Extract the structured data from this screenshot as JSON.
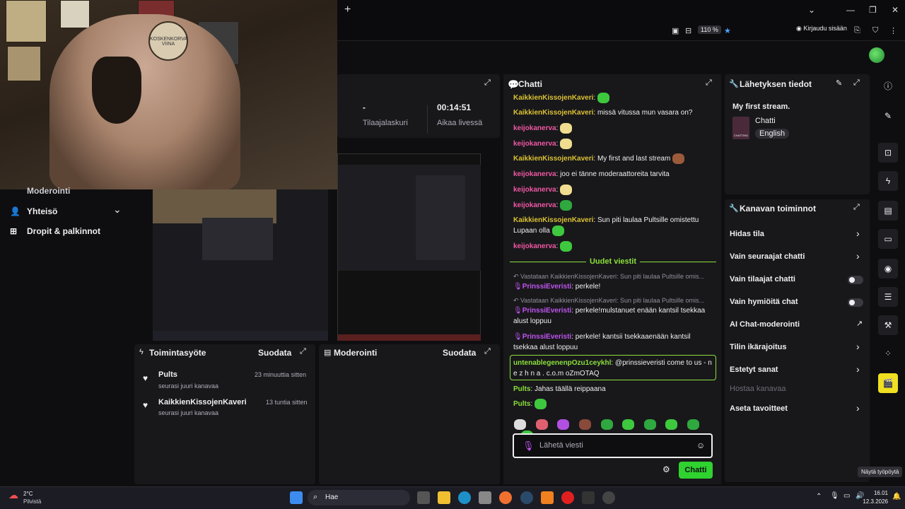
{
  "stats": {
    "left_value": "-",
    "left_label": "Tilaajalaskuri",
    "right_value": "00:14:51",
    "right_label": "Aikaa livessä"
  },
  "browser": {
    "zoom": "110 %",
    "login": "Kirjaudu sisään"
  },
  "webcam": {
    "stamp_text": "KOSKENKORVA VIINA"
  },
  "leftnav": {
    "items": [
      "Moderointi",
      "Yhteisö",
      "Dropit & palkinnot"
    ]
  },
  "chat": {
    "title": "Chatti",
    "messages": [
      {
        "user": "KaikkienKissojenKaveri",
        "text": ""
      },
      {
        "user": "KaikkienKissojenKaveri",
        "text": ": missä vitussa mun vasara on?"
      },
      {
        "user": "keijokanerva",
        "text": ":"
      },
      {
        "user": "keijokanerva",
        "text": ":"
      },
      {
        "user": "KaikkienKissojenKaveri",
        "text": ": My first and last stream"
      },
      {
        "user": "keijokanerva",
        "text": ": joo ei tänne moderaattoreita tarvita"
      },
      {
        "user": "keijokanerva",
        "text": ":"
      },
      {
        "user": "keijokanerva",
        "text": ":"
      },
      {
        "user": "KaikkienKissojenKaveri",
        "text": ": Sun piti laulaa Pultsille omistettu Lupaan olla"
      },
      {
        "user": "keijokanerva",
        "text": ":"
      }
    ],
    "new_messages_label": "Uudet viestit",
    "replies": [
      {
        "reply_to": "Vastataan KaikkienKissojenKaveri: Sun piti laulaa Pultsille omis...",
        "user": "PrinssiEveristi",
        "text": ": perkele!"
      },
      {
        "reply_to": "Vastataan KaikkienKissojenKaveri: Sun piti laulaa Pultsille omis...",
        "user": "PrinssiEveristi",
        "text": ": perkele!mulstanuet enään kantsil tsekkaa alust loppuu"
      },
      {
        "reply_to": "",
        "user": "PrinssiEveristi",
        "text": ": perkele! kantsii tsekkaaenään kantsil tsekkaa alust loppuu"
      }
    ],
    "highlighted": {
      "user": "untenablegenenpOzu1ceykhl",
      "text": ": @prinssieveristi come to us - n e z h n a . c.o.m oZmOTAQ"
    },
    "tail": [
      {
        "user": "Pults",
        "text": ": Jahas täällä reippaana"
      },
      {
        "user": "Pults",
        "text": ":"
      }
    ],
    "input_placeholder": "Lähetä viesti",
    "send_label": "Chatti"
  },
  "stream_info": {
    "title": "Lähetyksen tiedot",
    "stream_title": "My first stream.",
    "category": "Chatti",
    "language": "English",
    "thumb_caption": "CHATTING"
  },
  "channel_actions": {
    "title": "Kanavan toiminnot",
    "items": [
      {
        "label": "Hidas tila",
        "control": "arrow"
      },
      {
        "label": "Vain seuraajat chatti",
        "control": "arrow"
      },
      {
        "label": "Vain tilaajat chatti",
        "control": "toggle"
      },
      {
        "label": "Vain hymiöitä chat",
        "control": "toggle"
      },
      {
        "label": "AI Chat-moderointi",
        "control": "external"
      },
      {
        "label": "Tilin ikärajoitus",
        "control": "arrow"
      },
      {
        "label": "Estetyt sanat",
        "control": "arrow"
      },
      {
        "label": "Hostaa kanavaa",
        "control": "none"
      },
      {
        "label": "Aseta tavoitteet",
        "control": "arrow"
      }
    ]
  },
  "activity": {
    "title": "Toimintasyöte",
    "filter": "Suodata",
    "items": [
      {
        "user": "Pults",
        "sub": "seurasi juuri kanavaa",
        "time": "23 minuuttia sitten"
      },
      {
        "user": "KaikkienKissojenKaveri",
        "sub": "seurasi juuri kanavaa",
        "time": "13 tuntia sitten"
      }
    ]
  },
  "moderation": {
    "title": "Moderointi",
    "filter": "Suodata"
  },
  "tooltip": "Näytä työpöytä",
  "taskbar": {
    "weather_temp": "2°C",
    "weather_text": "Pilvistä",
    "search": "Hae",
    "time": "16.01",
    "date": "12.3.2026"
  }
}
